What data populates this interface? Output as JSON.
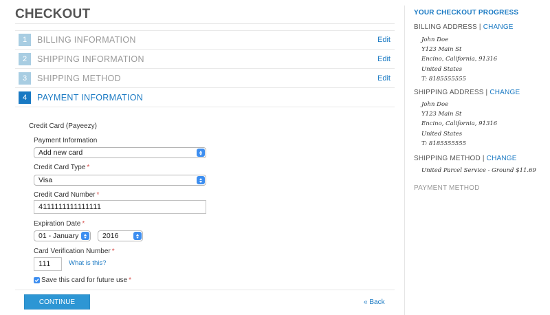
{
  "page": {
    "title": "CHECKOUT"
  },
  "steps": [
    {
      "number": "1",
      "label": "BILLING INFORMATION",
      "edit": "Edit"
    },
    {
      "number": "2",
      "label": "SHIPPING INFORMATION",
      "edit": "Edit"
    },
    {
      "number": "3",
      "label": "SHIPPING METHOD",
      "edit": "Edit"
    },
    {
      "number": "4",
      "label": "PAYMENT INFORMATION"
    }
  ],
  "payment": {
    "method_title": "Credit Card (Payeezy)",
    "payment_info_label": "Payment Information",
    "payment_info_value": "Add new card",
    "card_type_label": "Credit Card Type",
    "card_type_value": "Visa",
    "card_number_label": "Credit Card Number",
    "card_number_value": "4111111111111111",
    "expiration_label": "Expiration Date",
    "exp_month_value": "01 - January",
    "exp_year_value": "2016",
    "cvv_label": "Card Verification Number",
    "cvv_value": "111",
    "cvv_help": "What is this?",
    "save_card_label": "Save this card for future use",
    "save_card_checked": true,
    "required_mark": "*"
  },
  "actions": {
    "continue": "CONTINUE",
    "back": "« Back"
  },
  "sidebar": {
    "title": "YOUR CHECKOUT PROGRESS",
    "billing": {
      "heading": "BILLING ADDRESS |",
      "change": "CHANGE",
      "lines": [
        "John Doe",
        "Y123 Main St",
        "Encino, California, 91316",
        "United States",
        "T: 8185555555"
      ]
    },
    "shipping": {
      "heading": "SHIPPING ADDRESS |",
      "change": "CHANGE",
      "lines": [
        "John Doe",
        "Y123 Main St",
        "Encino, California, 91316",
        "United States",
        "T: 8185555555"
      ]
    },
    "shipping_method": {
      "heading": "SHIPPING METHOD |",
      "change": "CHANGE",
      "value": "United Parcel Service - Ground $11.69"
    },
    "payment_method": {
      "heading": "PAYMENT METHOD"
    }
  },
  "colors": {
    "accent": "#1979c3",
    "step_inactive": "#a8cde2",
    "button": "#2d96d4",
    "required": "#d9534f"
  }
}
